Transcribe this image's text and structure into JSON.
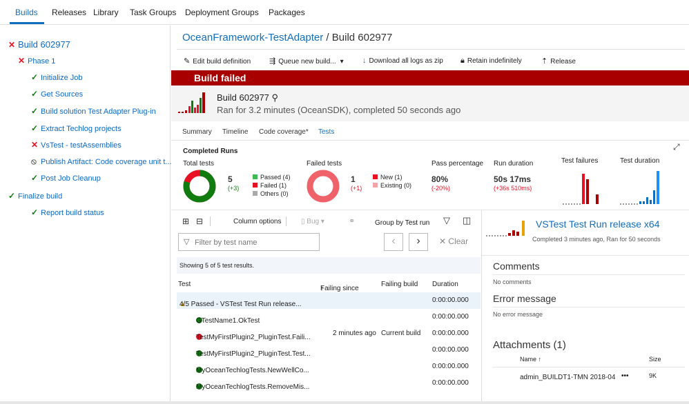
{
  "topnav": {
    "tabs": [
      "Builds",
      "Releases",
      "Library",
      "Task Groups",
      "Deployment Groups",
      "Packages"
    ]
  },
  "tree": {
    "build": "Build 602977",
    "phase": "Phase 1",
    "steps": [
      {
        "label": "Initialize Job",
        "status": "ok"
      },
      {
        "label": "Get Sources",
        "status": "ok"
      },
      {
        "label": "Build solution Test Adapter Plug-in",
        "status": "ok"
      },
      {
        "label": "Extract Techlog projects",
        "status": "ok"
      },
      {
        "label": "VsTest - testAssemblies",
        "status": "fail"
      },
      {
        "label": "Publish Artifact: Code coverage unit t...",
        "status": "skipped"
      },
      {
        "label": "Post Job Cleanup",
        "status": "ok"
      }
    ],
    "finalize": "Finalize build",
    "report": "Report build status"
  },
  "header": {
    "project": "OceanFramework-TestAdapter",
    "separator": " / ",
    "build": "Build 602977"
  },
  "toolbar": {
    "edit": "Edit build definition",
    "queue": "Queue new build...",
    "download": "Download all logs as zip",
    "retain": "Retain indefinitely",
    "release": "Release"
  },
  "banner": "Build failed",
  "buildinfo": {
    "title": "Build 602977",
    "subtitle": "Ran for 3.2 minutes (OceanSDK), completed 50 seconds ago"
  },
  "subtabs": [
    "Summary",
    "Timeline",
    "Code coverage*",
    "Tests"
  ],
  "summary": {
    "title": "Completed Runs",
    "total_label": "Total tests",
    "total": "5",
    "total_delta": "(+3)",
    "passed": "Passed (4)",
    "failed": "Failed (1)",
    "others": "Others (0)",
    "failed_label": "Failed tests",
    "failed_count": "1",
    "failed_delta": "(+1)",
    "new": "New (1)",
    "existing": "Existing (0)",
    "pass_label": "Pass percentage",
    "pass_value": "80%",
    "pass_delta": "(-20%)",
    "duration_label": "Run duration",
    "duration_value": "50s 17ms",
    "duration_delta": "(+36s 510ms)",
    "failures_label": "Test failures",
    "tduration_label": "Test duration",
    "passed_count": 4,
    "failed_count_n": 1
  },
  "testtoolbar": {
    "column_options": "Column options",
    "bug": "Bug",
    "group_by": "Group by",
    "group_value": "Test run",
    "filter_placeholder": "Filter by test name",
    "clear": "Clear"
  },
  "results": {
    "showing": "Showing 5 of 5 test results.",
    "col_test": "Test",
    "col_failing_since": "Failing since",
    "col_failing_build": "Failing build",
    "col_duration": "Duration",
    "group": {
      "label": "4/5 Passed - VSTest Test Run release...",
      "duration": "0:00:00.000"
    },
    "rows": [
      {
        "name": "GTestName1.OkTest",
        "status": "ok",
        "since": "",
        "build": "",
        "duration": "0:00:00.000"
      },
      {
        "name": "TestMyFirstPlugin2_PluginTest.Faili...",
        "status": "fail",
        "since": "2 minutes ago",
        "build": "Current build",
        "duration": "0:00:00.000"
      },
      {
        "name": "TestMyFirstPlugin2_PluginTest.Test...",
        "status": "ok",
        "since": "",
        "build": "",
        "duration": "0:00:00.000"
      },
      {
        "name": "MyOceanTechlogTests.NewWellCo...",
        "status": "ok",
        "since": "",
        "build": "",
        "duration": "0:00:00.000"
      },
      {
        "name": "MyOceanTechlogTests.RemoveMis...",
        "status": "ok",
        "since": "",
        "build": "",
        "duration": "0:00:00.000"
      }
    ]
  },
  "details": {
    "title": "VSTest Test Run release x64",
    "subtitle": "Completed 3 minutes ago, Ran for 50 seconds",
    "comments_title": "Comments",
    "comments_text": "No comments",
    "error_title": "Error message",
    "error_text": "No error message",
    "attachments_title": "Attachments (1)",
    "att_name_col": "Name",
    "att_size_col": "Size",
    "att_name": "admin_BUILDT1-TMN 2018-04",
    "att_more": "•••",
    "att_size": "9K"
  },
  "colors": {
    "accent": "#106ebe",
    "fail": "#e81123",
    "pass": "#107c10",
    "banner": "#a80000"
  }
}
